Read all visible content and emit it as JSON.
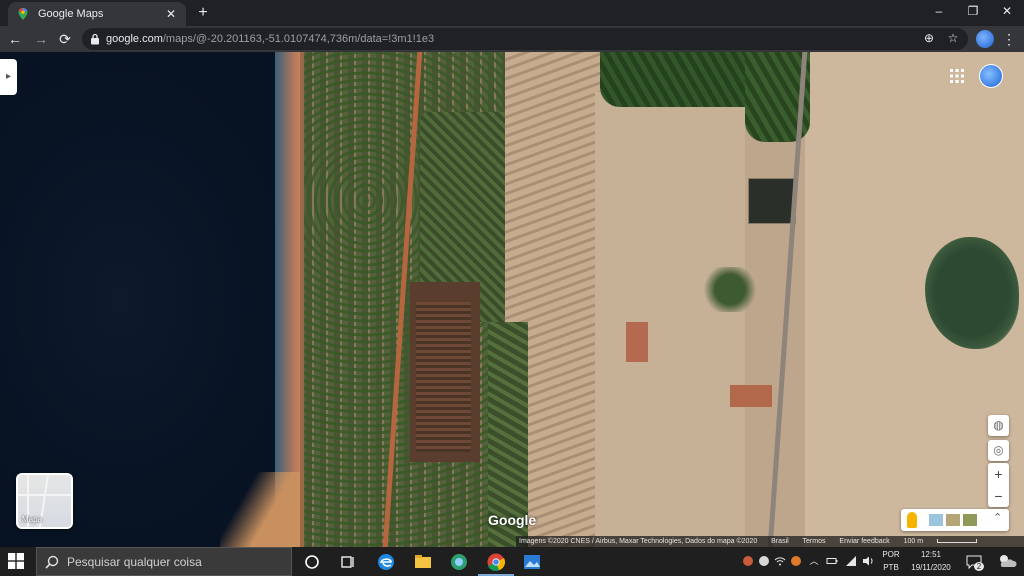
{
  "browser": {
    "tab": {
      "title": "Google Maps",
      "close": "✕"
    },
    "new_tab": "+",
    "window_controls": {
      "minimize": "–",
      "restore": "❐",
      "close": "✕"
    },
    "nav": {
      "back": "←",
      "forward": "→",
      "reload": "⟳"
    },
    "address": {
      "host": "google.com",
      "path": "/maps/@-20.201163,-51.0107474,736m/data=!3m1!1e3"
    },
    "toolbar_icons": {
      "install": "⊕",
      "bookmark": "☆",
      "menu": "⋮"
    }
  },
  "map": {
    "side_toggle": "▸",
    "apps_icon": "⋮⋮⋮",
    "layer_button_label": "Mapa",
    "watermark": "Google",
    "controls": {
      "globe": "◍",
      "locate": "◎",
      "zoom_in": "+",
      "zoom_out": "−",
      "expand": "⌃"
    },
    "attribution": {
      "imagery": "Imagens ©2020 CNES / Airbus, Maxar Technologies, Dados do mapa ©2020",
      "country": "Brasil",
      "terms": "Termos",
      "feedback": "Enviar feedback",
      "scale": "100 m"
    }
  },
  "taskbar": {
    "search_placeholder": "Pesquisar qualquer coisa",
    "language": "POR",
    "keyboard": "PTB",
    "time": "12:51",
    "date": "19/11/2020",
    "notification_count": "2",
    "up_arrow": "︿"
  }
}
